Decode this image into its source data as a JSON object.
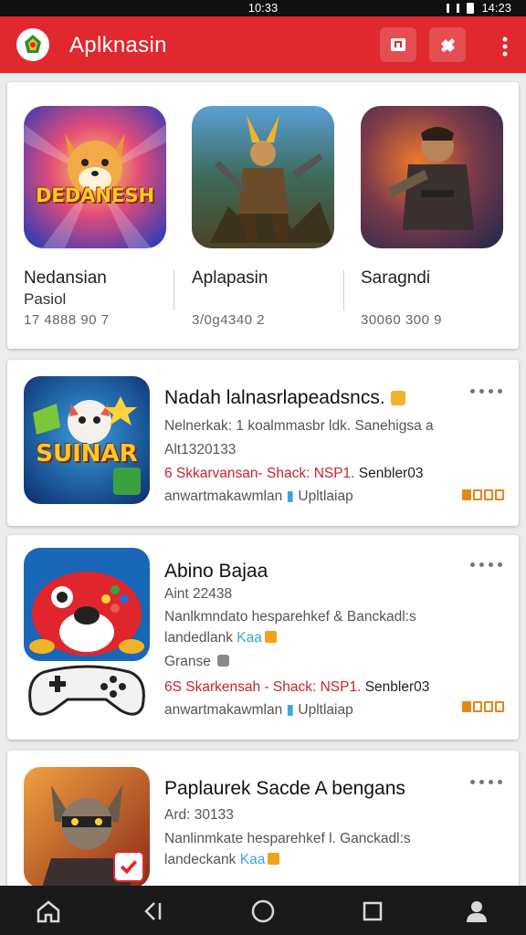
{
  "status_bar": {
    "time": "10:33",
    "right_text": "14:23"
  },
  "app_bar": {
    "title": "Aplknasin",
    "brand_color": "#e0282e",
    "icons": [
      "logo-icon",
      "store-icon",
      "puzzle-icon",
      "more-vert-icon"
    ]
  },
  "featured": [
    {
      "name": "Nedansian",
      "subtitle": "Pasiol",
      "number": "17 4888 90 7",
      "icon_text": "DEDANESH"
    },
    {
      "name": "Aplapasin",
      "subtitle": "",
      "number": "3/0g4340 2",
      "icon_text": ""
    },
    {
      "name": "Saragndi",
      "subtitle": "",
      "number": "30060 300 9",
      "icon_text": ""
    }
  ],
  "apps": [
    {
      "title": "Nadah lalnasrlapeadsncs.",
      "meta1": "Nelnerkak: 1 koalmmasbr ldk. Sanehigsa a",
      "meta2": "Alt1320133",
      "red_prefix": "6 Skkarvansan- Shack: NSP1. ",
      "red_rest": "Senbler03",
      "footer": "anwartmakawmlan",
      "footer_tag": "Upltlaiap",
      "icon_text": "SUINAR"
    },
    {
      "title": "Abino Bajaa",
      "meta1": "Aint 22438",
      "meta2": "Nanlkmndato hesparehkef & Banckadl:s",
      "meta2b": "landedlank",
      "meta2b_tag": "Kaa",
      "genre": "Granse",
      "red_prefix": "6S Skarkensah - Shack: NSP1. ",
      "red_rest": "Senbler03",
      "footer": "anwartmakawmlan",
      "footer_tag": "Upltlaiap"
    },
    {
      "title": "Paplaurek Sacde A bengans",
      "meta1": "Ard: 30133",
      "meta2": "Nanlinmkate hesparehkef l. Ganckadl:s",
      "meta2b": "landeckank",
      "meta2b_tag": "Kaa"
    }
  ],
  "nav_bar": {
    "icons": [
      "home-icon",
      "back-icon",
      "circle-home-icon",
      "recents-icon",
      "profile-icon"
    ]
  }
}
